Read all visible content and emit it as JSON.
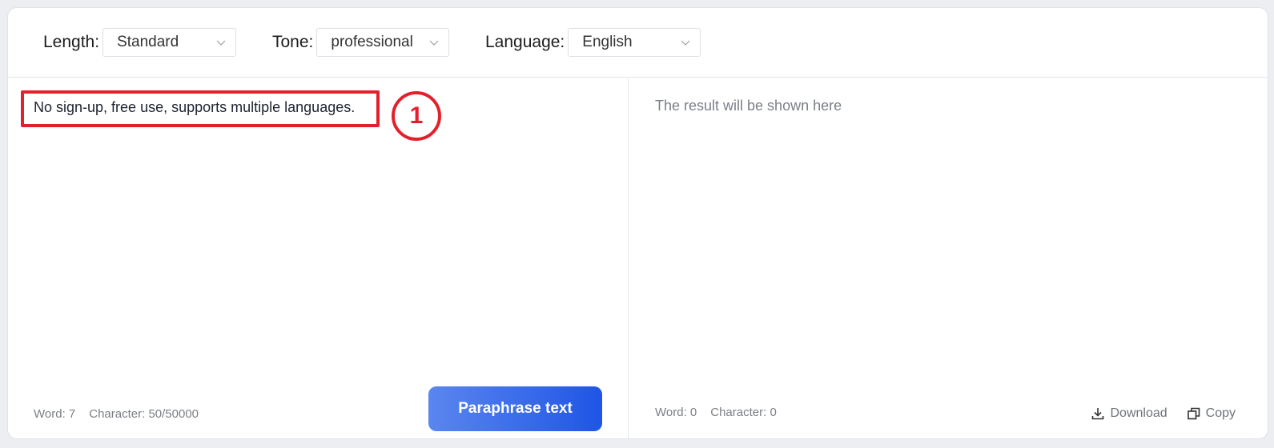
{
  "toolbar": {
    "length": {
      "label": "Length:",
      "value": "Standard"
    },
    "tone": {
      "label": "Tone:",
      "value": "professional"
    },
    "language": {
      "label": "Language:",
      "value": "English"
    }
  },
  "input": {
    "text": "No sign-up, free use, supports multiple languages.",
    "word_count": "Word: 7",
    "char_count": "Character: 50/50000",
    "button_label": "Paraphrase text"
  },
  "annotation": {
    "step_number": "1",
    "color": "#e3202c"
  },
  "output": {
    "placeholder": "The result will be shown here",
    "word_count": "Word: 0",
    "char_count": "Character: 0",
    "download_label": "Download",
    "copy_label": "Copy"
  },
  "icons": [
    "chevron-down-icon",
    "download-icon",
    "copy-icon"
  ],
  "colors": {
    "accent": "#1f55e6",
    "accent_light": "#5b86ef"
  }
}
